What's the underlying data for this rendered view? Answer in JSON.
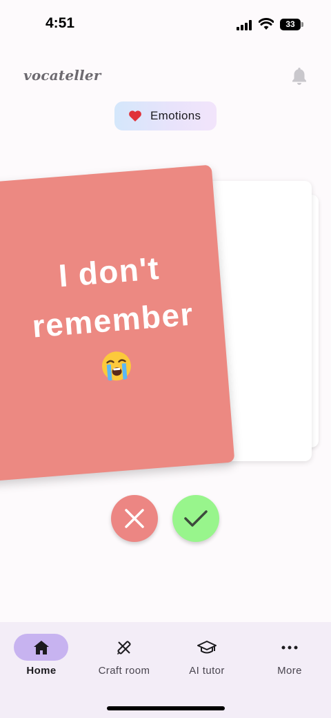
{
  "status_bar": {
    "time": "4:51",
    "battery": "33"
  },
  "header": {
    "logo": "vocateller",
    "bell_icon": "bell-icon"
  },
  "category": {
    "label": "Emotions",
    "icon": "heart-icon",
    "icon_color": "#e0323a"
  },
  "card": {
    "text_line1": "I don't",
    "text_line2": "remember",
    "emoji": "crying-face-emoji",
    "color": "#ec8982"
  },
  "actions": {
    "wrong": {
      "icon": "close-icon",
      "color": "#ec8683"
    },
    "right": {
      "icon": "check-icon",
      "color": "#98f58c"
    }
  },
  "nav": {
    "items": [
      {
        "label": "Home",
        "icon": "home-icon",
        "active": true
      },
      {
        "label": "Craft room",
        "icon": "craft-icon",
        "active": false
      },
      {
        "label": "AI tutor",
        "icon": "graduation-cap-icon",
        "active": false
      },
      {
        "label": "More",
        "icon": "more-icon",
        "active": false
      }
    ],
    "active_color": "#c7b3f0"
  }
}
